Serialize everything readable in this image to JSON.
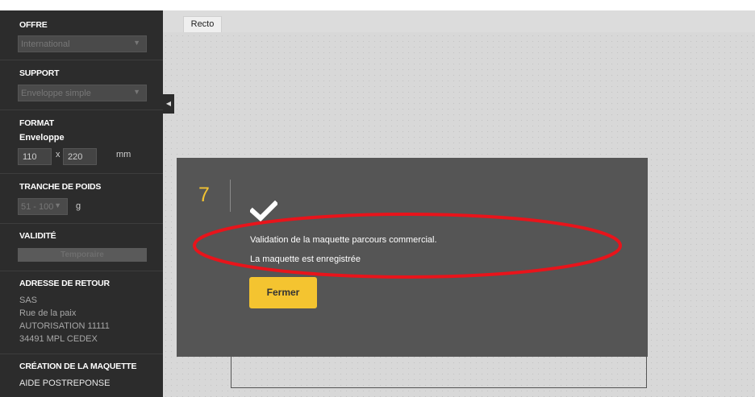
{
  "sidebar": {
    "offre": {
      "title": "OFFRE",
      "value": "International"
    },
    "support": {
      "title": "SUPPORT",
      "value": "Enveloppe simple"
    },
    "format": {
      "title": "FORMAT",
      "subtitle": "Enveloppe",
      "width": "110",
      "sep": "x",
      "height": "220",
      "unit": "mm"
    },
    "poids": {
      "title": "TRANCHE DE POIDS",
      "value": "51 - 100",
      "unit": "g"
    },
    "validite": {
      "title": "VALIDITÉ",
      "button": "Temporaire"
    },
    "adresse": {
      "title": "ADRESSE DE RETOUR",
      "lines": [
        "SAS",
        "Rue de la paix",
        "AUTORISATION 11111",
        "34491 MPL CEDEX"
      ]
    },
    "creation": {
      "title": "CRÉATION DE LA MAQUETTE",
      "value": "AIDE POSTREPONSE"
    }
  },
  "main": {
    "tab": "Recto"
  },
  "modal": {
    "step": "7",
    "message_line1": "Validation de la maquette parcours commercial.",
    "message_line2": "La maquette est enregistrée",
    "close_button": "Fermer",
    "icon": "check-icon"
  },
  "colors": {
    "accent": "#f4c430",
    "step": "#f1c232",
    "annotation": "#e8141b",
    "modal_bg": "#555555",
    "sidebar_bg": "#2c2c2c"
  }
}
